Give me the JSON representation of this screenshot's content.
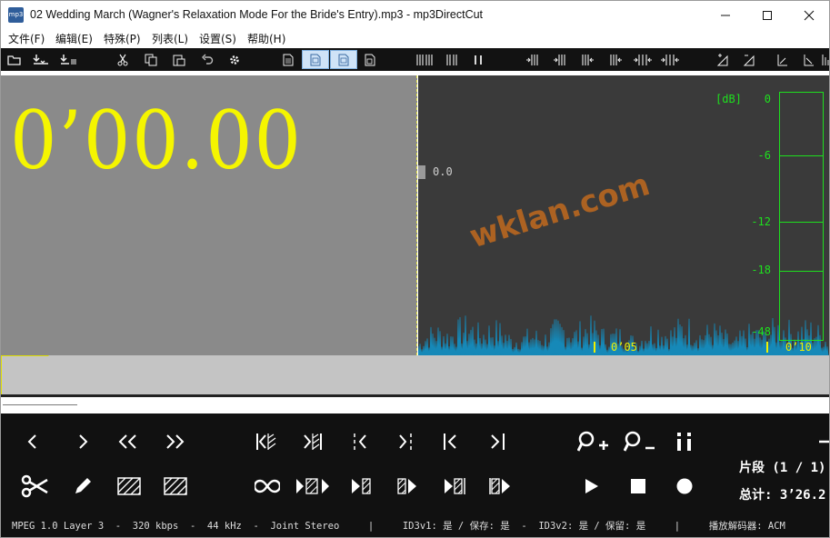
{
  "window": {
    "title": "02 Wedding March (Wagner's Relaxation Mode For the Bride's Entry).mp3 - mp3DirectCut",
    "icon_label": "mp3"
  },
  "menu": [
    "文件(F)",
    "编辑(E)",
    "特殊(P)",
    "列表(L)",
    "设置(S)",
    "帮助(H)"
  ],
  "toolbar": {
    "icons": [
      "open-icon",
      "save-icon",
      "save-list-icon",
      "cut-icon",
      "copy-icon",
      "paste-icon",
      "undo-icon",
      "settings-icon",
      "document-icon",
      "doc-selected-icon",
      "doc-selected-2-icon",
      "doc-info-icon",
      "split-icon",
      "split-2-icon",
      "pause-icon",
      "set-begin-icon",
      "set-begin-2-icon",
      "set-end-icon",
      "set-end-2-icon",
      "set-both-icon",
      "set-both-2-icon",
      "volume-up-icon",
      "volume-down-icon",
      "fade-in-icon",
      "fade-out-icon",
      "normalize-icon"
    ]
  },
  "timer": {
    "time": "0’00.00"
  },
  "waveform": {
    "position_label": "0.0",
    "watermark": "wklan.com",
    "ticks": [
      "0’05",
      "0’10"
    ],
    "wave_color": "#1689b8",
    "bg_color": "#3a3a3a"
  },
  "meter": {
    "unit": "[dB]",
    "labels": [
      "0",
      "-6",
      "-12",
      "-18",
      "-48"
    ],
    "color": "#1ee01e"
  },
  "controls": {
    "row1": [
      "prev-icon",
      "next-icon",
      "rewind-icon",
      "fast-forward-icon",
      "goto-begin-marker-icon",
      "goto-end-marker-icon",
      "goto-prev-cue-icon",
      "goto-next-cue-icon",
      "goto-start-icon",
      "goto-end-icon",
      "zoom-in-icon",
      "zoom-out-icon",
      "info-icon"
    ],
    "row2": [
      "scissors-icon",
      "pencil-icon",
      "hatched-block-icon",
      "hatched-block-2-icon",
      "loop-icon",
      "play-selection-icon",
      "play-to-marker-icon",
      "play-from-marker-icon",
      "play-region-icon",
      "play-region-2-icon",
      "play-icon",
      "stop-icon",
      "record-icon"
    ],
    "segment": "片段 (1 / 1)",
    "total": "总计: 3’26.2"
  },
  "status": "MPEG 1.0 Layer 3  -  320 kbps  -  44 kHz  -  Joint Stereo     |     ID3v1: 是 / 保存: 是  -  ID3v2: 是 / 保留: 是     |     播放解码器: ACM"
}
